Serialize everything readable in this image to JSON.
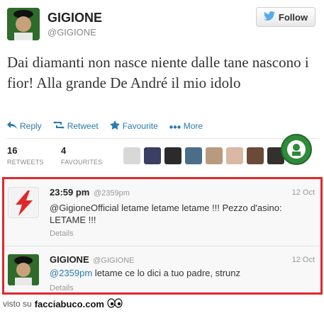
{
  "tweet": {
    "name": "GIGIONE",
    "handle": "@GIGIONE",
    "follow_label": "Follow",
    "text": "Dai diamanti non nasce niente dalle tane nascono i fior! Alla grande De André il mio idolo",
    "actions": {
      "reply": "Reply",
      "retweet": "Retweet",
      "favourite": "Favourite",
      "more": "More"
    },
    "stats": {
      "retweets_count": "16",
      "retweets_label": "RETWEETS",
      "favourites_count": "4",
      "favourites_label": "FAVOURITES"
    },
    "favourite_avatars": 9
  },
  "replies": [
    {
      "name": "23:59 pm",
      "handle": "@2359pm",
      "date": "12 Oct",
      "mention": "",
      "text": "@GigioneOfficial letame letame letame !!! Pezzo d'asino: LETAME !!!",
      "details": "Details"
    },
    {
      "name": "GIGIONE",
      "handle": "@GIGIONE",
      "date": "12 Oct",
      "mention": "@2359pm",
      "text": " letame ce lo dici a tuo padre, strunz",
      "details": "Details"
    }
  ],
  "footer": {
    "prefix": "visto su",
    "site": "facciabuco.com"
  },
  "colors": {
    "link": "#2a7ab0",
    "highlight_border": "#e0282c",
    "badge": "#2e8b3a"
  },
  "icons": [
    "twitter-bird-icon",
    "reply-icon",
    "retweet-icon",
    "star-icon",
    "more-dots-icon",
    "lightning-logo-icon",
    "eyes-icon"
  ]
}
